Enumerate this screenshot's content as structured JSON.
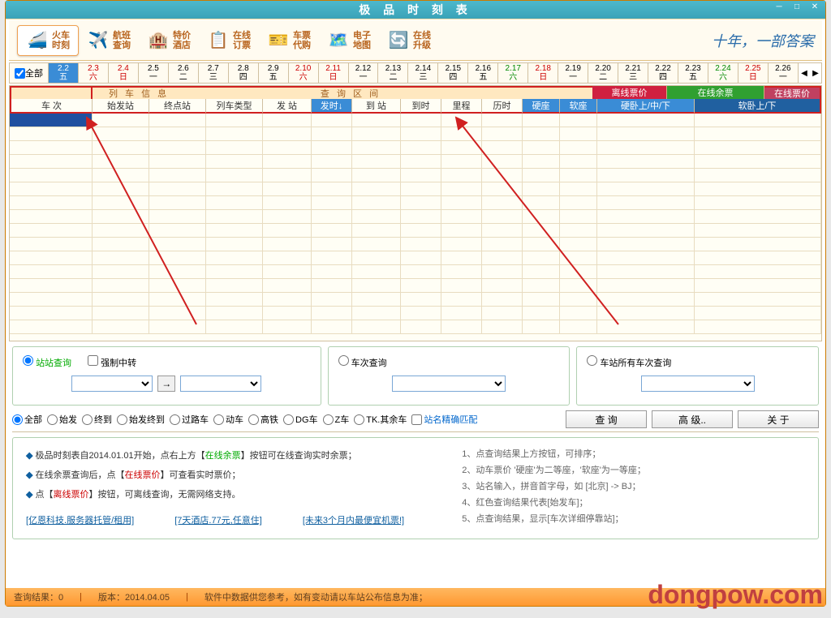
{
  "app": {
    "title": "极 品 时 刻 表"
  },
  "toolbar": [
    {
      "name": "train-schedule",
      "icon": "🚄",
      "label": "火车\n时刻",
      "active": true
    },
    {
      "name": "flight-query",
      "icon": "✈️",
      "label": "航班\n查询"
    },
    {
      "name": "special-hotel",
      "icon": "🏨",
      "label": "特价\n酒店"
    },
    {
      "name": "online-booking",
      "icon": "📋",
      "label": "在线\n订票"
    },
    {
      "name": "ticket-agent",
      "icon": "🎫",
      "label": "车票\n代购"
    },
    {
      "name": "emap",
      "icon": "🗺️",
      "label": "电子\n地图"
    },
    {
      "name": "online-upgrade",
      "icon": "🔄",
      "label": "在线\n升级"
    }
  ],
  "logo_text": "十年，一部答案",
  "datebar": {
    "all_label": "全部",
    "dates": [
      {
        "d": "2.2",
        "w": "五",
        "sel": true
      },
      {
        "d": "2.3",
        "w": "六",
        "cls": "red"
      },
      {
        "d": "2.4",
        "w": "日",
        "cls": "red"
      },
      {
        "d": "2.5",
        "w": "一"
      },
      {
        "d": "2.6",
        "w": "二"
      },
      {
        "d": "2.7",
        "w": "三"
      },
      {
        "d": "2.8",
        "w": "四"
      },
      {
        "d": "2.9",
        "w": "五"
      },
      {
        "d": "2.10",
        "w": "六",
        "cls": "red"
      },
      {
        "d": "2.11",
        "w": "日",
        "cls": "red"
      },
      {
        "d": "2.12",
        "w": "一"
      },
      {
        "d": "2.13",
        "w": "二"
      },
      {
        "d": "2.14",
        "w": "三"
      },
      {
        "d": "2.15",
        "w": "四"
      },
      {
        "d": "2.16",
        "w": "五"
      },
      {
        "d": "2.17",
        "w": "六",
        "cls": "green"
      },
      {
        "d": "2.18",
        "w": "日",
        "cls": "red"
      },
      {
        "d": "2.19",
        "w": "一"
      },
      {
        "d": "2.20",
        "w": "二"
      },
      {
        "d": "2.21",
        "w": "三"
      },
      {
        "d": "2.22",
        "w": "四"
      },
      {
        "d": "2.23",
        "w": "五"
      },
      {
        "d": "2.24",
        "w": "六",
        "cls": "green"
      },
      {
        "d": "2.25",
        "w": "日",
        "cls": "red"
      },
      {
        "d": "2.26",
        "w": "一"
      }
    ]
  },
  "header_groups": {
    "train_no": "",
    "train_info": "列 车 信 息",
    "query_range": "查 询 区 间",
    "offline_price": "离线票价",
    "online_remain": "在线余票",
    "online_price": "在线票价"
  },
  "columns": {
    "c0": "车  次",
    "c1": "始发站",
    "c2": "终点站",
    "c3": "列车类型",
    "c4": "发  站",
    "c5": "发时↓",
    "c6": "到  站",
    "c7": "到时",
    "c8": "里程",
    "c9": "历时",
    "c10": "硬座",
    "c11": "软座",
    "c12": "硬卧上/中/下",
    "c13": "软卧上/下"
  },
  "panels": {
    "p1_radio": "站站查询",
    "p1_check": "强制中转",
    "p2_radio": "车次查询",
    "p3_radio": "车站所有车次查询"
  },
  "filters": {
    "f0": "全部",
    "f1": "始发",
    "f2": "终到",
    "f3": "始发终到",
    "f4": "过路车",
    "f5": "动车",
    "f6": "高铁",
    "f7": "DG车",
    "f8": "Z车",
    "f9": "TK.其余车",
    "exact": "站名精确匹配"
  },
  "buttons": {
    "query": "查   询",
    "advanced": "高  级..",
    "about": "关  于"
  },
  "info": {
    "l1a": "极品时刻表自2014.01.01开始，点右上方【",
    "l1b": "在线余票",
    "l1c": "】按钮可在线查询实时余票；",
    "l2a": "在线余票查询后，点【",
    "l2b": "在线票价",
    "l2c": "】可查看实时票价；",
    "l3a": "点【",
    "l3b": "离线票价",
    "l3c": "】按钮，可离线查询，无需网络支持。",
    "r1": "1、点查询结果上方按钮，可排序；",
    "r2": "2、动车票价 '硬座'为二等座，'软座'为一等座；",
    "r3": "3、站名输入，拼音首字母，如 [北京] -> BJ；",
    "r4": "4、红色查询结果代表[始发车]；",
    "r5": "5、点查询结果，显示[车次详细停靠站]；"
  },
  "links": {
    "k1": "[亿恩科技.服务器托管/租用]",
    "k2": "[7天酒店.77元,任意住]",
    "k3": "[未来3个月内最便宜机票!]"
  },
  "status": {
    "result": "查询结果：0",
    "version": "版本：2014.04.05",
    "note": "软件中数据供您参考，如有变动请以车站公布信息为准；"
  },
  "watermark": "dongpow.com"
}
